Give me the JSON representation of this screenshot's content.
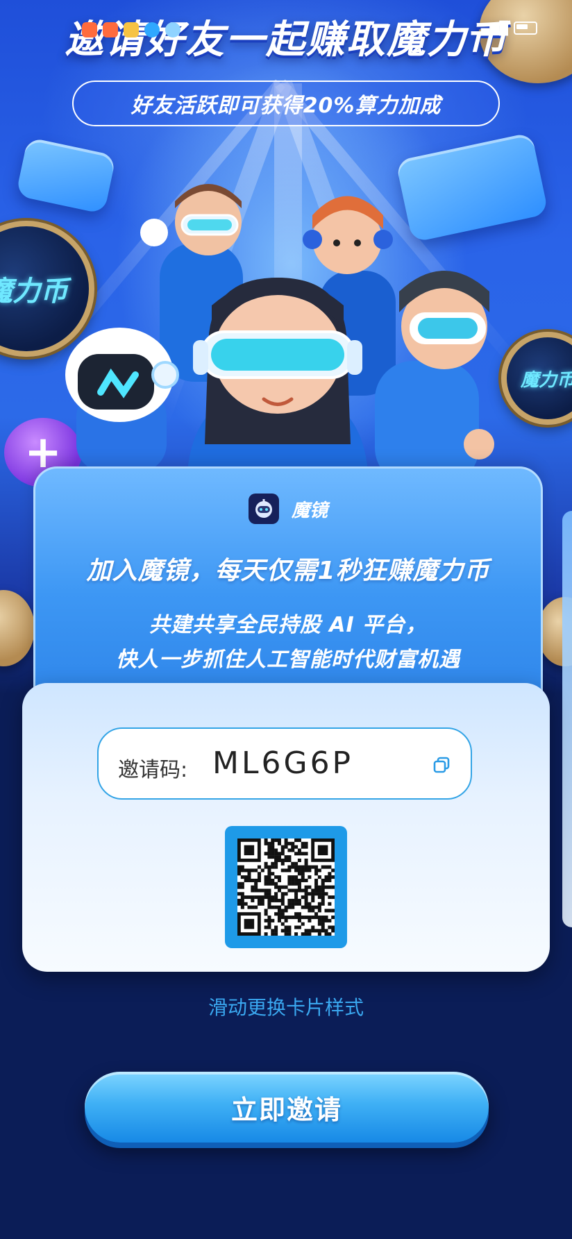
{
  "hero": {
    "title": "邀请好友一起赚取魔力币",
    "subtitle": "好友活跃即可获得20%算力加成",
    "coin_label": "魔力币"
  },
  "card": {
    "brand_name": "魔镜",
    "headline": "加入魔镜，每天仅需1秒狂赚魔力币",
    "desc_line1": "共建共享全民持股 AI 平台，",
    "desc_line2": "快人一步抓住人工智能时代财富机遇"
  },
  "invite": {
    "code_label": "邀请码:",
    "code_value": "ML6G6P"
  },
  "swipe_hint": "滑动更换卡片样式",
  "invite_button_label": "立即邀请",
  "icons": {
    "copy": "copy-icon",
    "brand": "robot-logo-icon",
    "qr": "qr-code"
  },
  "colors": {
    "accent": "#1e9ae8",
    "button": "#3fb0f5",
    "background": "#0b1d57"
  }
}
